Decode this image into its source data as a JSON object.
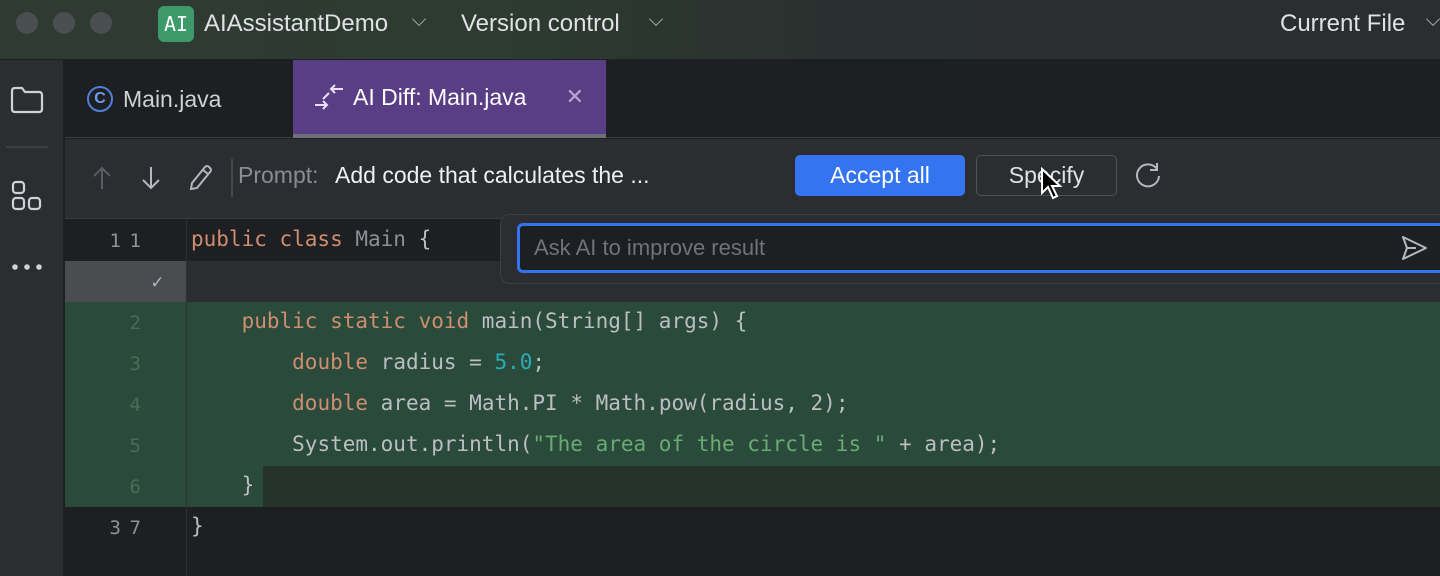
{
  "titlebar": {
    "project_badge": "AI",
    "project_name": "AIAssistantDemo",
    "vcs_label": "Version control",
    "run_config": "Current File"
  },
  "toolstrip": {
    "icons": [
      "folder-icon",
      "structure-icon",
      "more-icon"
    ]
  },
  "tabs": [
    {
      "label": "Main.java",
      "icon": "java-class-icon",
      "active": false
    },
    {
      "label": "AI Diff: Main.java",
      "icon": "diff-icon",
      "active": true,
      "closable": true
    }
  ],
  "diff_toolbar": {
    "prompt_label": "Prompt:",
    "prompt_text": "Add code that calculates the ...",
    "accept_all_label": "Accept all",
    "specify_label": "Specify"
  },
  "specify_popup": {
    "placeholder": "Ask AI to improve result",
    "value": ""
  },
  "gutter": [
    {
      "left": "1",
      "right": "1"
    },
    {
      "left": "",
      "right": "✓"
    },
    {
      "left": "",
      "right": "2"
    },
    {
      "left": "",
      "right": "3"
    },
    {
      "left": "",
      "right": "4"
    },
    {
      "left": "",
      "right": "5"
    },
    {
      "left": "",
      "right": "6"
    },
    {
      "left": "3",
      "right": "7"
    }
  ],
  "code": {
    "line1": {
      "kw": "public class ",
      "cls": "Main",
      "rest": " {"
    },
    "line2": {
      "kw": "public static void ",
      "rest": "main(String[] args) {"
    },
    "line3": {
      "kw": "double ",
      "rest_a": "radius = ",
      "num": "5.0",
      "rest_b": ";"
    },
    "line4": {
      "kw": "double ",
      "rest": "area = Math.PI * Math.pow(radius, 2);"
    },
    "line5": {
      "rest_a": "System.out.println(",
      "str": "\"The area of the circle is \"",
      "rest_b": " + area);"
    },
    "line6": {
      "rest": "}"
    },
    "line7": {
      "rest": "}"
    }
  },
  "colors": {
    "accent": "#3574f0",
    "diff_tab": "#5a3e85",
    "added_line": "#2a4a3b",
    "keyword": "#cf8e6d",
    "string": "#6aab73",
    "number": "#2aacb8"
  }
}
